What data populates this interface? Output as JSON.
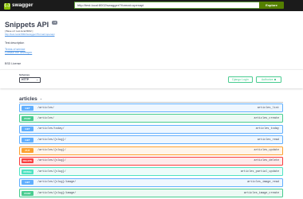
{
  "topbar": {
    "logo_glyph": "{..}",
    "brand": "swagger",
    "url": "http://test.local:8002/swagger/?format=openapi",
    "explore_label": "Explore"
  },
  "info": {
    "title": "Snippets API",
    "version": "v1",
    "base_url": "[ Base url: test.local:8002 ]",
    "spec_url": "http://test.local:8002/swagger/?format=openapi",
    "description": "Test description",
    "terms_label": "Terms of service",
    "contact_label": "Contact the developer",
    "license": "BSD License"
  },
  "schemes": {
    "label": "Schemes",
    "selected": "HTTP",
    "django_login_label": "Django Login",
    "authorize_label": "Authorize"
  },
  "tag": {
    "name": "articles",
    "operations": [
      {
        "method": "GET",
        "path": "/articles/",
        "op_id": "articles_list",
        "kind": "get"
      },
      {
        "method": "POST",
        "path": "/articles/",
        "op_id": "articles_create",
        "kind": "post"
      },
      {
        "method": "GET",
        "path": "/articles/today/",
        "op_id": "articles_today",
        "kind": "get"
      },
      {
        "method": "GET",
        "path": "/articles/{slug}/",
        "op_id": "articles_read",
        "kind": "get"
      },
      {
        "method": "PUT",
        "path": "/articles/{slug}/",
        "op_id": "articles_update",
        "kind": "put"
      },
      {
        "method": "DELETE",
        "path": "/articles/{slug}/",
        "op_id": "articles_delete",
        "kind": "delete"
      },
      {
        "method": "PATCH",
        "path": "/articles/{slug}/",
        "op_id": "articles_partial_update",
        "kind": "patch"
      },
      {
        "method": "GET",
        "path": "/articles/{slug}/image/",
        "op_id": "articles_image_read",
        "kind": "get"
      },
      {
        "method": "POST",
        "path": "/articles/{slug}/image/",
        "op_id": "articles_image_create",
        "kind": "post"
      }
    ]
  },
  "colors": {
    "get": "#61affe",
    "post": "#49cc90",
    "put": "#fca130",
    "delete": "#f93e3e",
    "patch": "#50e3c2",
    "topbar": "#1b1b1b",
    "explore": "#547f00"
  },
  "icons": [
    "swagger-logo-icon",
    "chevron-down-icon",
    "lock-icon"
  ]
}
